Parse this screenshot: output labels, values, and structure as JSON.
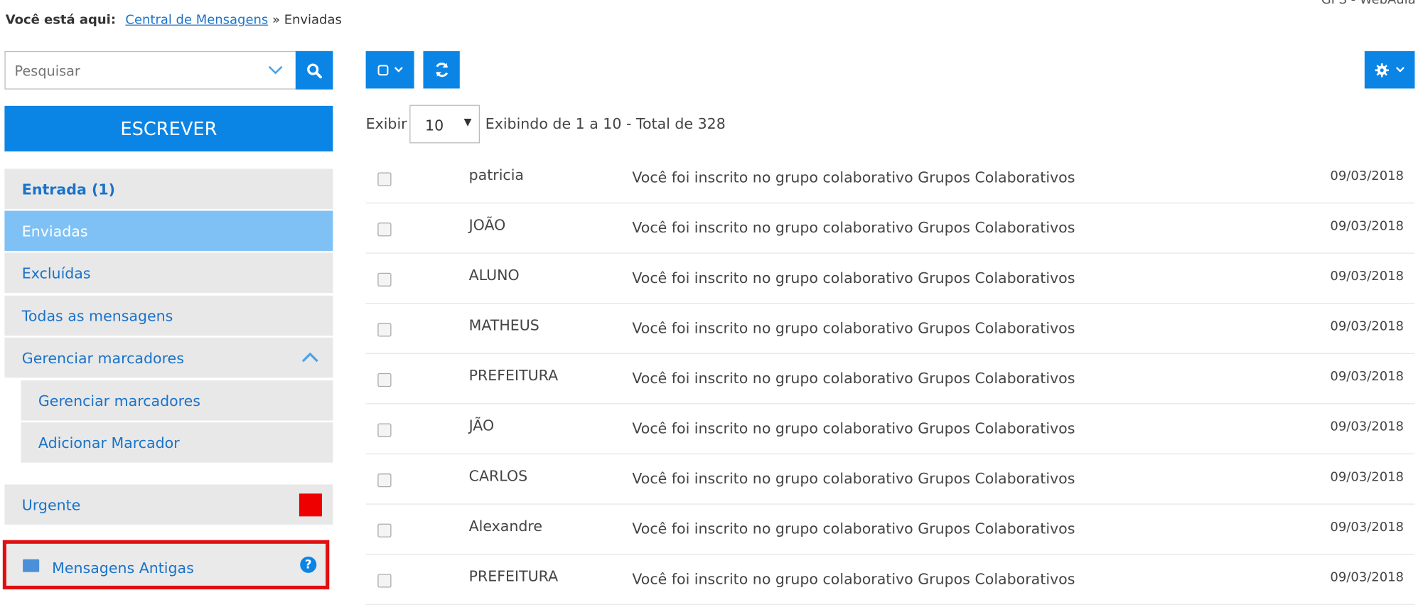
{
  "breadcrumb": {
    "label": "Você está aqui:",
    "link": "Central de Mensagens",
    "separator": "»",
    "current": "Enviadas"
  },
  "app_title": "GPS - WebAula",
  "search": {
    "placeholder": "Pesquisar"
  },
  "compose_label": "ESCREVER",
  "sidebar": {
    "inbox": "Entrada (1)",
    "sent": "Enviadas",
    "deleted": "Excluídas",
    "all": "Todas as mensagens",
    "manage_group": "Gerenciar marcadores",
    "manage_sub": "Gerenciar marcadores",
    "add_label": "Adicionar Marcador",
    "urgent": "Urgente",
    "urgent_color": "#ee0000",
    "old_messages": "Mensagens Antigas"
  },
  "list": {
    "show_label": "Exibir",
    "per_page": "10",
    "summary": "Exibindo de 1 a 10 - Total de 328",
    "rows": [
      {
        "from": "patricia",
        "subject": "Você foi inscrito no grupo colaborativo Grupos Colaborativos",
        "date": "09/03/2018"
      },
      {
        "from": "JOÃO",
        "subject": "Você foi inscrito no grupo colaborativo Grupos Colaborativos",
        "date": "09/03/2018"
      },
      {
        "from": "ALUNO",
        "subject": "Você foi inscrito no grupo colaborativo Grupos Colaborativos",
        "date": "09/03/2018"
      },
      {
        "from": "MATHEUS",
        "subject": "Você foi inscrito no grupo colaborativo Grupos Colaborativos",
        "date": "09/03/2018"
      },
      {
        "from": "PREFEITURA",
        "subject": "Você foi inscrito no grupo colaborativo Grupos Colaborativos",
        "date": "09/03/2018"
      },
      {
        "from": "JÃO",
        "subject": "Você foi inscrito no grupo colaborativo Grupos Colaborativos",
        "date": "09/03/2018"
      },
      {
        "from": "CARLOS",
        "subject": "Você foi inscrito no grupo colaborativo Grupos Colaborativos",
        "date": "09/03/2018"
      },
      {
        "from": "Alexandre",
        "subject": "Você foi inscrito no grupo colaborativo Grupos Colaborativos",
        "date": "09/03/2018"
      },
      {
        "from": "PREFEITURA",
        "subject": "Você foi inscrito no grupo colaborativo Grupos Colaborativos",
        "date": "09/03/2018"
      }
    ]
  },
  "colors": {
    "primary": "#0a85e6",
    "active_nav": "#7fc1f5",
    "highlight_border": "#e01010"
  }
}
